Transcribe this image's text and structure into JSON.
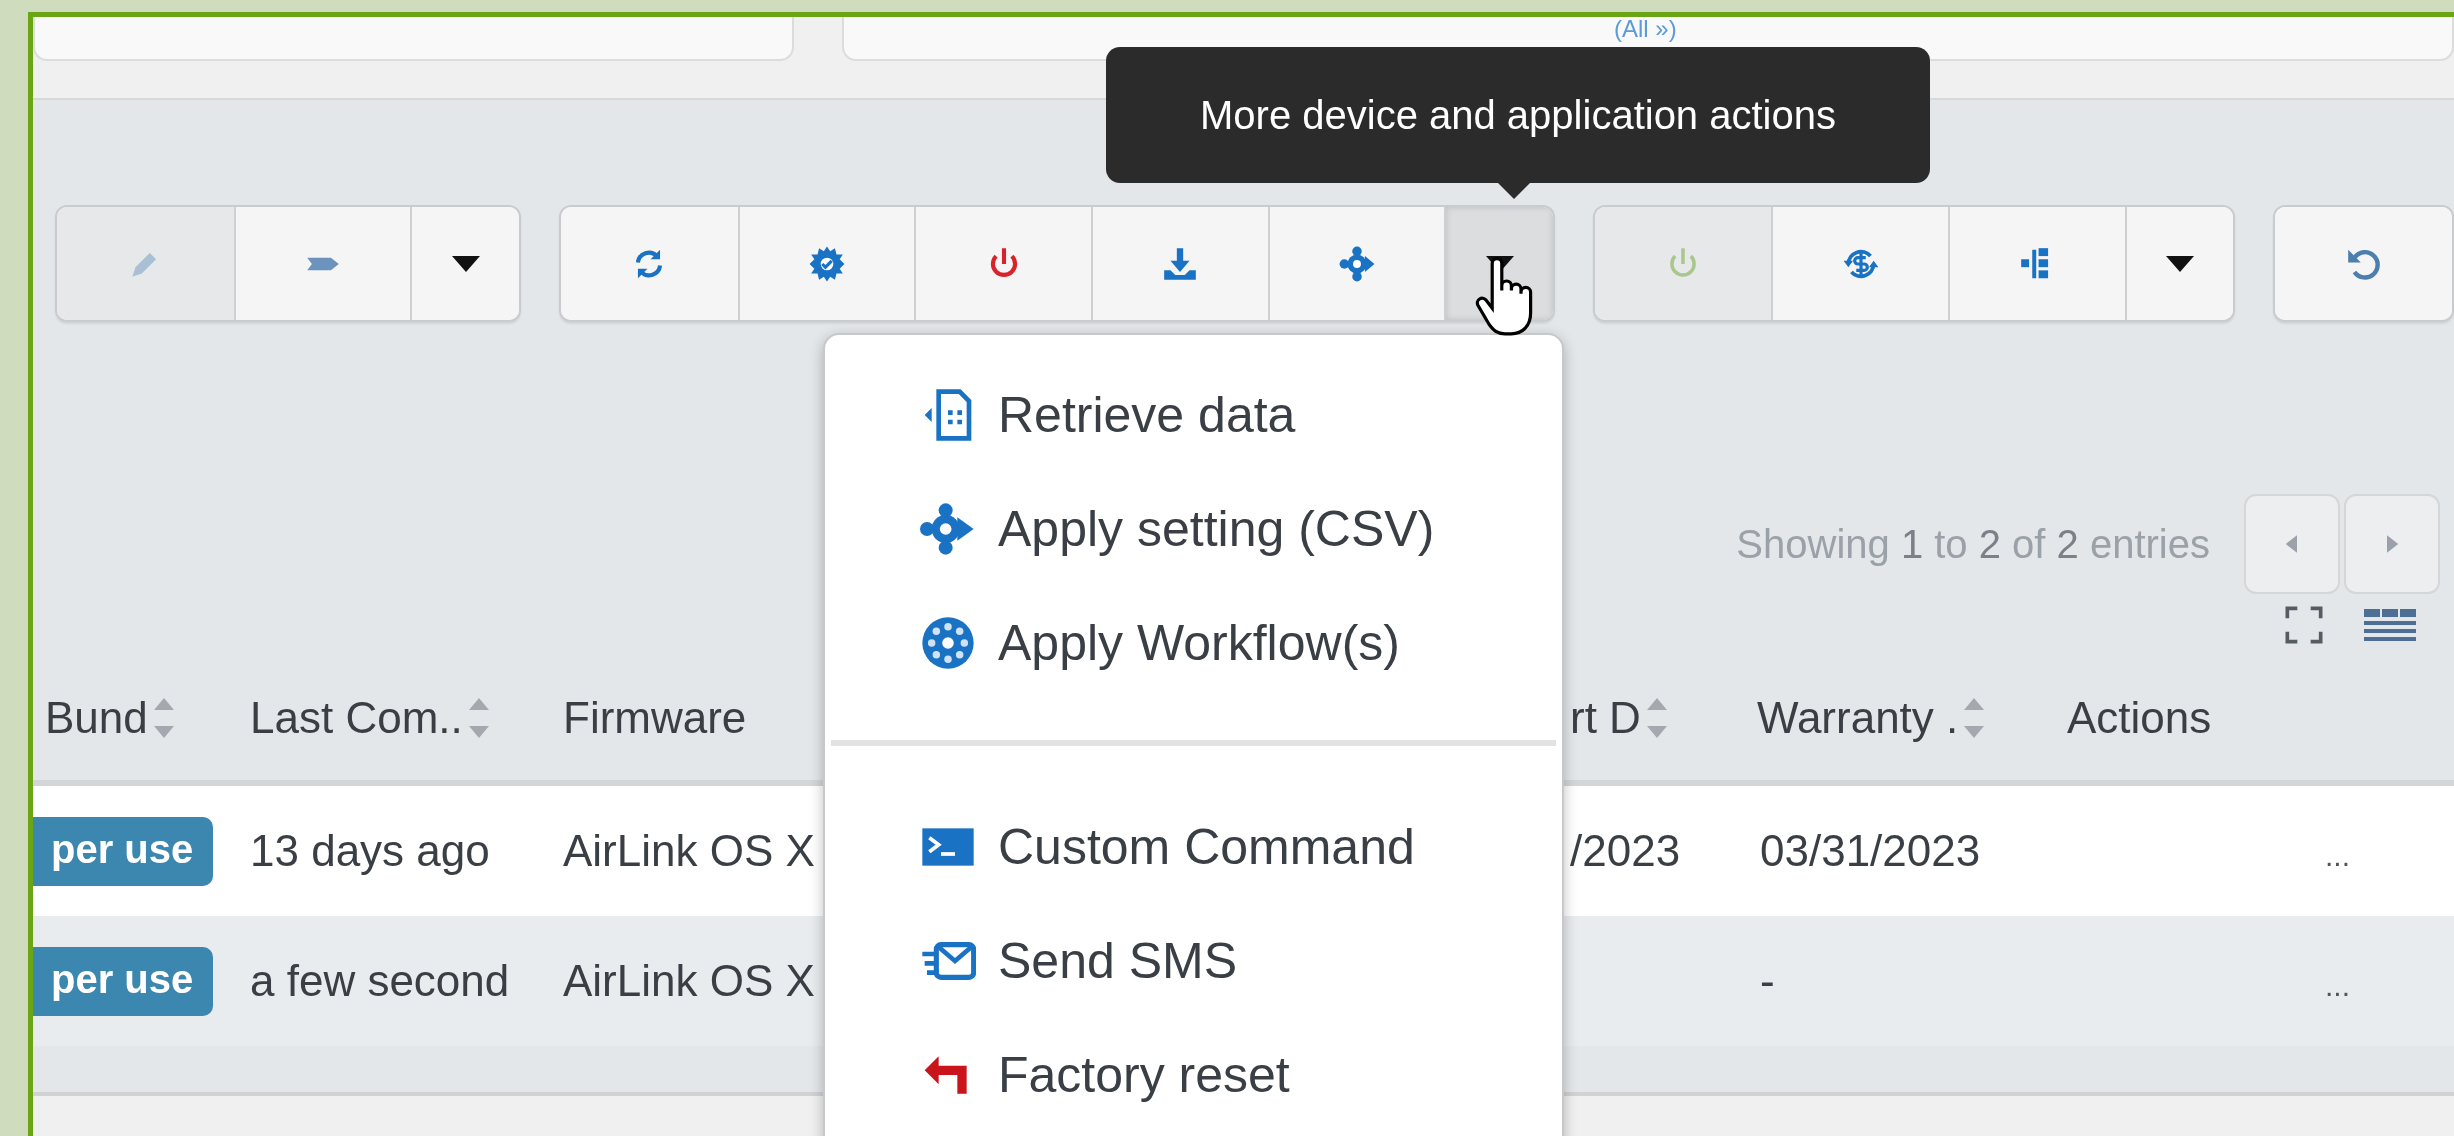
{
  "filter_bar": {
    "link": "(All »)"
  },
  "toolbar": {
    "groups": [
      {
        "buttons": [
          {
            "kind": "pencil",
            "disabled": true,
            "hovered": false
          },
          {
            "kind": "tag",
            "disabled": false,
            "hovered": false
          },
          {
            "kind": "caret",
            "disabled": false,
            "hovered": false
          }
        ]
      },
      {
        "buttons": [
          {
            "kind": "sync",
            "disabled": false,
            "hovered": false
          },
          {
            "kind": "workflow",
            "disabled": false,
            "hovered": false
          },
          {
            "kind": "power",
            "disabled": false,
            "hovered": false
          },
          {
            "kind": "download",
            "disabled": false,
            "hovered": false
          },
          {
            "kind": "settings",
            "disabled": false,
            "hovered": false
          },
          {
            "kind": "caret",
            "disabled": false,
            "hovered": true
          }
        ]
      },
      {
        "buttons": [
          {
            "kind": "power-on",
            "disabled": true,
            "hovered": false
          },
          {
            "kind": "sync-dollar",
            "disabled": false,
            "hovered": false
          },
          {
            "kind": "tree",
            "disabled": false,
            "hovered": false
          },
          {
            "kind": "caret",
            "disabled": false,
            "hovered": false
          }
        ]
      },
      {
        "buttons": [
          {
            "kind": "undo",
            "disabled": false,
            "hovered": false
          }
        ]
      }
    ]
  },
  "tooltip": {
    "text": "More device and application actions"
  },
  "dropdown_menu": {
    "items": [
      {
        "kind": "retrieve",
        "label": "Retrieve data"
      },
      {
        "kind": "apply-setting",
        "label": "Apply setting (CSV)"
      },
      {
        "kind": "workflow",
        "label": "Apply Workflow(s)"
      },
      {
        "kind": "divider"
      },
      {
        "kind": "command",
        "label": "Custom Command"
      },
      {
        "kind": "sms",
        "label": "Send SMS"
      },
      {
        "kind": "reset",
        "label": "Factory reset"
      }
    ]
  },
  "pager": {
    "info": "Showing **1** to **2** of **2** entries"
  },
  "table": {
    "columns": [
      {
        "label": "Bund",
        "sortable": true,
        "kind": "badge"
      },
      {
        "label": "Last Com..",
        "sortable": true,
        "kind": "text"
      },
      {
        "label": "Firmware",
        "sortable": false,
        "kind": "text"
      },
      {
        "label": "rt D",
        "sortable": true,
        "kind": "text"
      },
      {
        "label": "Warranty .",
        "sortable": true,
        "kind": "text"
      },
      {
        "label": "Actions",
        "sortable": false,
        "kind": "actions"
      }
    ],
    "rows": [
      {
        "cells": [
          "per use",
          "13 days ago",
          "AirLink OS X",
          "/2023",
          "03/31/2023",
          "..."
        ]
      },
      {
        "cells": [
          "per use",
          "a few second",
          "AirLink OS X",
          "",
          "-",
          "..."
        ]
      }
    ]
  }
}
